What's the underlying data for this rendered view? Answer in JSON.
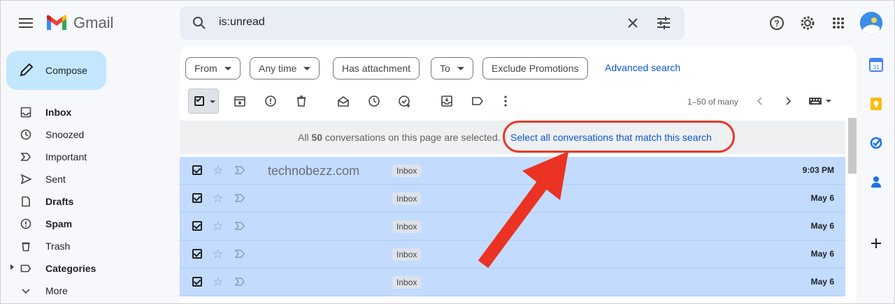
{
  "app": {
    "logo_text": "Gmail"
  },
  "search": {
    "query": "is:unread"
  },
  "compose": {
    "label": "Compose"
  },
  "nav": {
    "items": [
      {
        "label": "Inbox",
        "bold": true,
        "icon": "inbox-icon"
      },
      {
        "label": "Snoozed",
        "bold": false,
        "icon": "clock-icon"
      },
      {
        "label": "Important",
        "bold": false,
        "icon": "important-icon"
      },
      {
        "label": "Sent",
        "bold": false,
        "icon": "send-icon"
      },
      {
        "label": "Drafts",
        "bold": true,
        "icon": "draft-icon"
      },
      {
        "label": "Spam",
        "bold": true,
        "icon": "spam-icon"
      },
      {
        "label": "Trash",
        "bold": false,
        "icon": "trash-icon"
      },
      {
        "label": "Categories",
        "bold": true,
        "icon": "label-icon"
      },
      {
        "label": "More",
        "bold": false,
        "icon": "chevron-down-icon"
      }
    ]
  },
  "filters": {
    "from": "From",
    "any_time": "Any time",
    "has_attachment": "Has attachment",
    "to": "To",
    "exclude_promotions": "Exclude Promotions",
    "advanced_search": "Advanced search"
  },
  "toolbar": {
    "pager": "1–50 of many"
  },
  "banner": {
    "text_prefix": "All",
    "count": "50",
    "text_suffix": "conversations on this page are selected.",
    "select_all_link": "Select all conversations that match this search"
  },
  "rows": [
    {
      "sender": "technobezz.com",
      "label": "Inbox",
      "date": "9:03 PM"
    },
    {
      "sender": "",
      "label": "Inbox",
      "date": "May 6"
    },
    {
      "sender": "",
      "label": "Inbox",
      "date": "May 6"
    },
    {
      "sender": "",
      "label": "Inbox",
      "date": "May 6"
    },
    {
      "sender": "",
      "label": "Inbox",
      "date": "May 6"
    }
  ],
  "colors": {
    "accent": "#0b57d0",
    "selected_row": "#c2dbff",
    "compose": "#c2e7ff",
    "highlight": "#e8372a"
  }
}
